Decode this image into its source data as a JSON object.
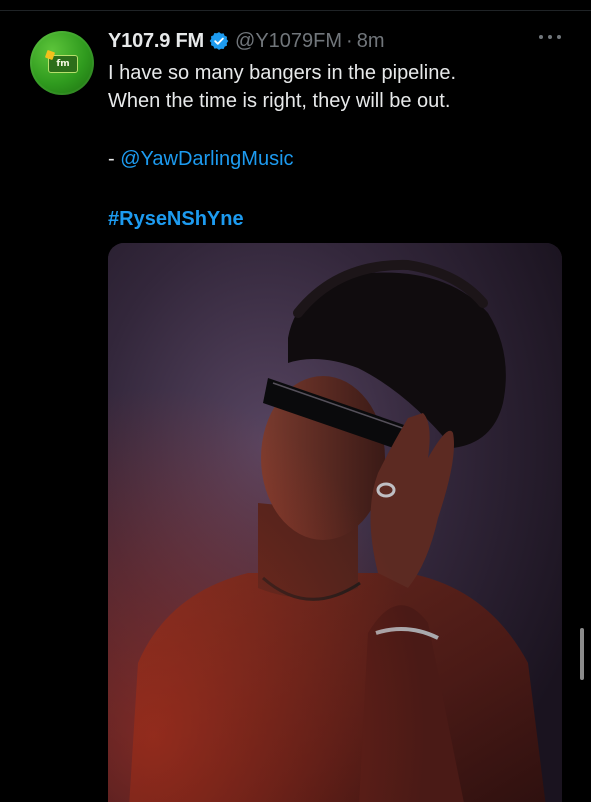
{
  "tweet": {
    "display_name": "Y107.9 FM",
    "verified_icon": "verified-badge-icon",
    "handle": "@Y1079FM",
    "separator": "·",
    "time": "8m",
    "text_line_1": "I have so many bangers in the pipeline.",
    "text_line_2": "When the time is right, they will be out.",
    "mention_prefix": "- ",
    "mention": "@YawDarlingMusic",
    "hashtag": "#RyseNShYne"
  },
  "avatar": {
    "logo_text": "fm"
  },
  "colors": {
    "background": "#000000",
    "text": "#e7e9ea",
    "secondary": "#71767b",
    "link": "#1d9bf0",
    "avatar_green": "#2f9a1e"
  },
  "icons": [
    "verified-badge-icon",
    "more-options-icon"
  ]
}
